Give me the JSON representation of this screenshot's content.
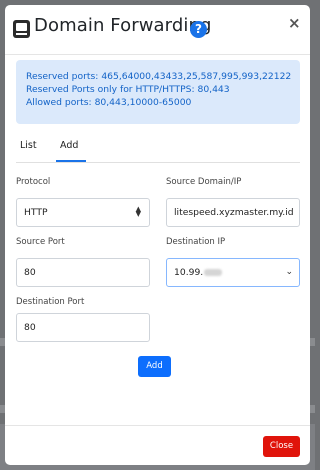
{
  "modal": {
    "title": "Domain Forwarding",
    "help_icon": "question-circle-icon",
    "title_icon": "server-icon",
    "close_icon": "×"
  },
  "alert": {
    "line1": "Reserved ports: 465,64000,43433,25,587,995,993,22122",
    "line2": "Reserved Ports only for HTTP/HTTPS: 80,443",
    "line3": "Allowed ports: 80,443,10000-65000"
  },
  "tabs": [
    {
      "label": "List",
      "active": false
    },
    {
      "label": "Add",
      "active": true
    }
  ],
  "form": {
    "protocol_label": "Protocol",
    "protocol_value": "HTTP",
    "source_domain_label": "Source Domain/IP",
    "source_domain_value": "litespeed.xyzmaster.my.id",
    "source_port_label": "Source Port",
    "source_port_value": "80",
    "destination_ip_label": "Destination IP",
    "destination_ip_value": "10.99.",
    "destination_port_label": "Destination Port",
    "destination_port_value": "80",
    "add_button": "Add"
  },
  "footer": {
    "close_button": "Close"
  },
  "colors": {
    "accent": "#0d6efd",
    "alert_bg": "#dbe9fb",
    "alert_text": "#1363c7",
    "danger": "#e0140b"
  }
}
